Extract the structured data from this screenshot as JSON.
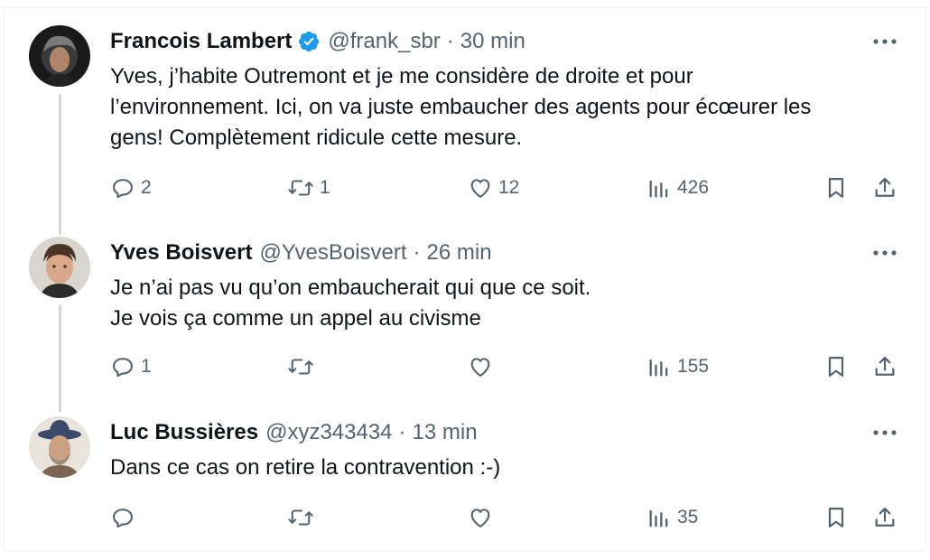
{
  "tweets": [
    {
      "name": "Francois Lambert",
      "verified": true,
      "handle": "@frank_sbr",
      "separator": "·",
      "time": "30 min",
      "body": [
        "Yves, j’habite Outremont et je me considère de droite et pour",
        "l’environnement. Ici, on va juste embaucher des agents pour écœurer les",
        "gens! Complètement ridicule cette mesure."
      ],
      "stats": {
        "replies": "2",
        "retweets": "1",
        "likes": "12",
        "views": "426"
      }
    },
    {
      "name": "Yves Boisvert",
      "verified": false,
      "handle": "@YvesBoisvert",
      "separator": "·",
      "time": "26 min",
      "body": [
        "Je n’ai pas vu qu’on embaucherait qui que ce soit.",
        "Je vois ça comme un appel au civisme"
      ],
      "stats": {
        "replies": "1",
        "retweets": "",
        "likes": "",
        "views": "155"
      }
    },
    {
      "name": "Luc Bussières",
      "verified": false,
      "handle": "@xyz343434",
      "separator": "·",
      "time": "13 min",
      "body": [
        "Dans ce cas on retire la contravention :-)"
      ],
      "stats": {
        "replies": "",
        "retweets": "",
        "likes": "",
        "views": "35"
      }
    }
  ],
  "icons": {
    "reply": "reply-icon",
    "retweet": "retweet-icon",
    "like": "like-icon",
    "views": "views-icon",
    "bookmark": "bookmark-icon",
    "share": "share-icon",
    "more": "more-icon",
    "verified": "verified-badge-icon"
  },
  "colors": {
    "text": "#0f1419",
    "secondary": "#536471",
    "verified": "#1d9bf0",
    "thread_line": "#cfd9de"
  }
}
